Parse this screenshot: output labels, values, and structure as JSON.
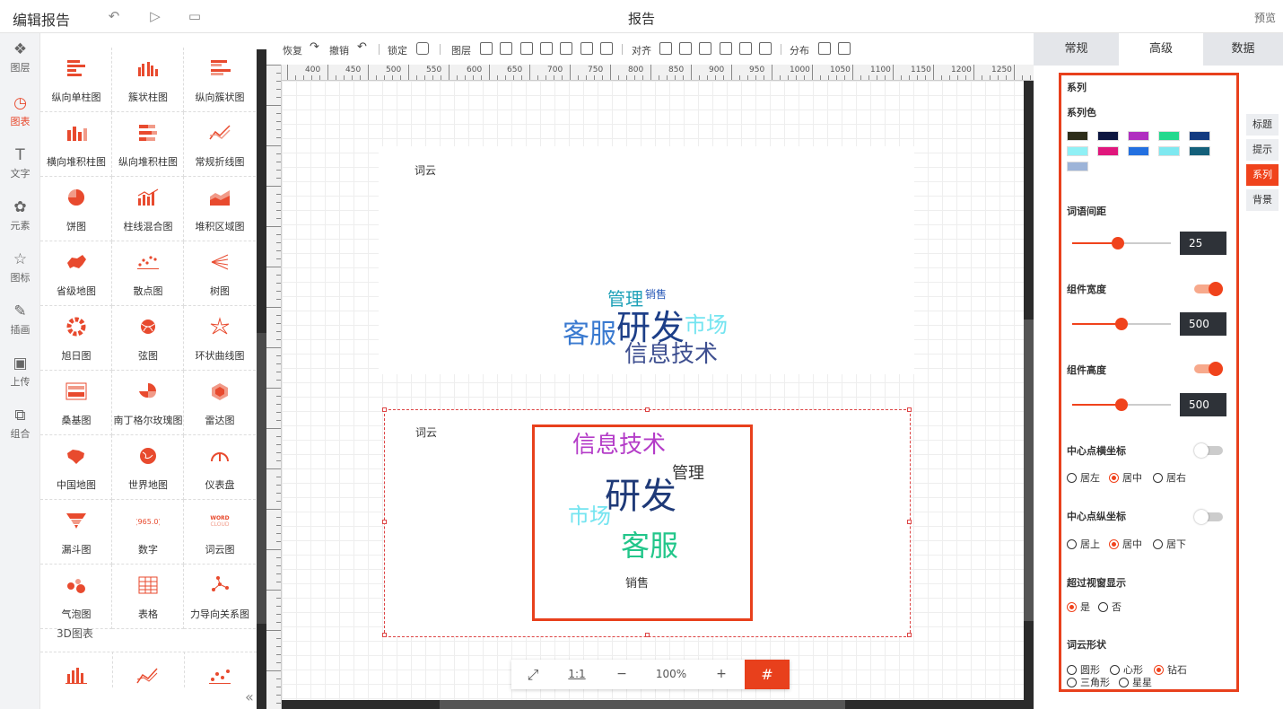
{
  "header": {
    "title": "编辑报告",
    "center_title": "报告",
    "preview": "预览"
  },
  "left_nav": [
    {
      "label": "图层",
      "icon": "layers-icon",
      "glyph": "❖"
    },
    {
      "label": "图表",
      "icon": "chart-icon",
      "glyph": "◷"
    },
    {
      "label": "文字",
      "icon": "text-icon",
      "glyph": "T"
    },
    {
      "label": "元素",
      "icon": "elements-icon",
      "glyph": "✿"
    },
    {
      "label": "图标",
      "icon": "star-icon",
      "glyph": "☆"
    },
    {
      "label": "插画",
      "icon": "palette-icon",
      "glyph": "✎"
    },
    {
      "label": "上传",
      "icon": "upload-image-icon",
      "glyph": "▣"
    },
    {
      "label": "组合",
      "icon": "group-icon",
      "glyph": "⧉"
    }
  ],
  "chart_types": [
    "纵向单柱图",
    "簇状柱图",
    "纵向簇状图",
    "横向堆积柱图",
    "纵向堆积柱图",
    "常规折线图",
    "饼图",
    "柱线混合图",
    "堆积区域图",
    "省级地图",
    "散点图",
    "树图",
    "旭日图",
    "弦图",
    "环状曲线图",
    "桑基图",
    "南丁格尔玫瑰图",
    "雷达图",
    "中国地图",
    "世界地图",
    "仪表盘",
    "漏斗图",
    "数字",
    "词云图",
    "气泡图",
    "表格",
    "力导向关系图"
  ],
  "number_icon_text": "965.0",
  "wordcloud_icon_text": "WORD CLOUD",
  "section_3d": "3D图表",
  "toolbar": {
    "undo": "恢复",
    "redo": "撤销",
    "lock": "锁定",
    "layer": "图层",
    "align": "对齐",
    "distribute": "分布"
  },
  "ruler_labels": [
    "400",
    "450",
    "500",
    "550",
    "600",
    "650",
    "700",
    "750",
    "800",
    "850",
    "900",
    "950",
    "1000",
    "1050",
    "1100",
    "1150",
    "1200",
    "1250"
  ],
  "widget1": {
    "title": "词云",
    "words": [
      {
        "text": "管理",
        "color": "#1fa1b8"
      },
      {
        "text": "销售",
        "color": "#2a5ab8"
      },
      {
        "text": "客服",
        "color": "#3a7ad0"
      },
      {
        "text": "研发",
        "color": "#1d3f88"
      },
      {
        "text": "市场",
        "color": "#74e4f0"
      },
      {
        "text": "信息技术",
        "color": "#3e4f90"
      }
    ]
  },
  "widget2": {
    "title": "词云",
    "words": [
      {
        "text": "信息技术",
        "color": "#b43cc8"
      },
      {
        "text": "管理",
        "color": "#333333"
      },
      {
        "text": "研发",
        "color": "#1f3a78"
      },
      {
        "text": "市场",
        "color": "#74e4f0"
      },
      {
        "text": "客服",
        "color": "#22c68a"
      },
      {
        "text": "销售",
        "color": "#333333"
      }
    ]
  },
  "zoom": {
    "fit": "⤢",
    "one_to_one": "1:1",
    "minus": "−",
    "value": "100%",
    "plus": "+",
    "grid": "#"
  },
  "right_tabs": [
    "常规",
    "高级",
    "数据"
  ],
  "side_tabs": [
    "标题",
    "提示",
    "系列",
    "背景"
  ],
  "panel": {
    "series": "系列",
    "series_color": "系列色",
    "swatches": [
      "#2d2d1a",
      "#0d1640",
      "#b02ec0",
      "#23d98e",
      "#123a80",
      "#8ff0f5",
      "#e0177c",
      "#2370e0",
      "#7ee8f0",
      "#14607a",
      "#9db4d8"
    ],
    "word_spacing": {
      "label": "词语间距",
      "value": "25"
    },
    "width": {
      "label": "组件宽度",
      "value": "500"
    },
    "height": {
      "label": "组件高度",
      "value": "500"
    },
    "center_x": {
      "label": "中心点横坐标",
      "options": [
        "居左",
        "居中",
        "居右"
      ],
      "selected": "居中"
    },
    "center_y": {
      "label": "中心点纵坐标",
      "options": [
        "居上",
        "居中",
        "居下"
      ],
      "selected": "居中"
    },
    "overflow": {
      "label": "超过视窗显示",
      "options": [
        "是",
        "否"
      ],
      "selected": "是"
    },
    "shape": {
      "label": "词云形状",
      "options": [
        "圆形",
        "心形",
        "钻石",
        "三角形",
        "星星"
      ],
      "selected": "钻石"
    }
  }
}
